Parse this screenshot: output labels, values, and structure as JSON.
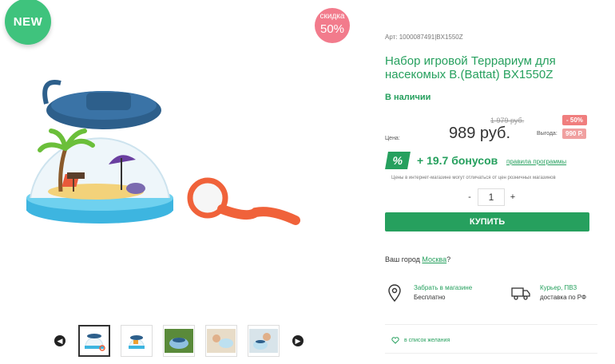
{
  "badges": {
    "new": "NEW",
    "sale_line1": "скидка",
    "sale_line2": "50%"
  },
  "gallery": {
    "prev_icon": "chevron-left-icon",
    "next_icon": "chevron-right-icon",
    "thumbnails": [
      "thumb-1",
      "thumb-2",
      "thumb-3",
      "thumb-4",
      "thumb-5"
    ]
  },
  "product": {
    "sku": "Арт: 1000087491|BX1550Z",
    "title": "Набор игровой Террариум для насекомых B.(Battat) BX1550Z",
    "stock": "В наличии",
    "old_price": "1 979 руб.",
    "discount": "- 50%",
    "price_label": "Цена:",
    "price": "989 руб.",
    "save_label": "Выгода:",
    "save_value": "990 Р."
  },
  "bonus": {
    "icon": "%",
    "text": "+ 19.7 бонусов",
    "link": "правила программы",
    "disclaimer": "Цены в интернет-магазине могут отличаться от цен розничных магазинов"
  },
  "quantity": {
    "minus": "-",
    "value": "1",
    "plus": "+"
  },
  "buy_button": "КУПИТЬ",
  "city": {
    "prefix": "Ваш город ",
    "name": "Москва",
    "suffix": "?"
  },
  "delivery": {
    "pickup_title": "Забрать в магазине",
    "pickup_sub": "Бесплатно",
    "courier_title": "Курьер, ПВЗ",
    "courier_sub": "доставка по РФ"
  },
  "wishlist": "в список желания",
  "colors": {
    "accent": "#26a05e",
    "new": "#3fc37d",
    "sale": "#f27b8c"
  }
}
